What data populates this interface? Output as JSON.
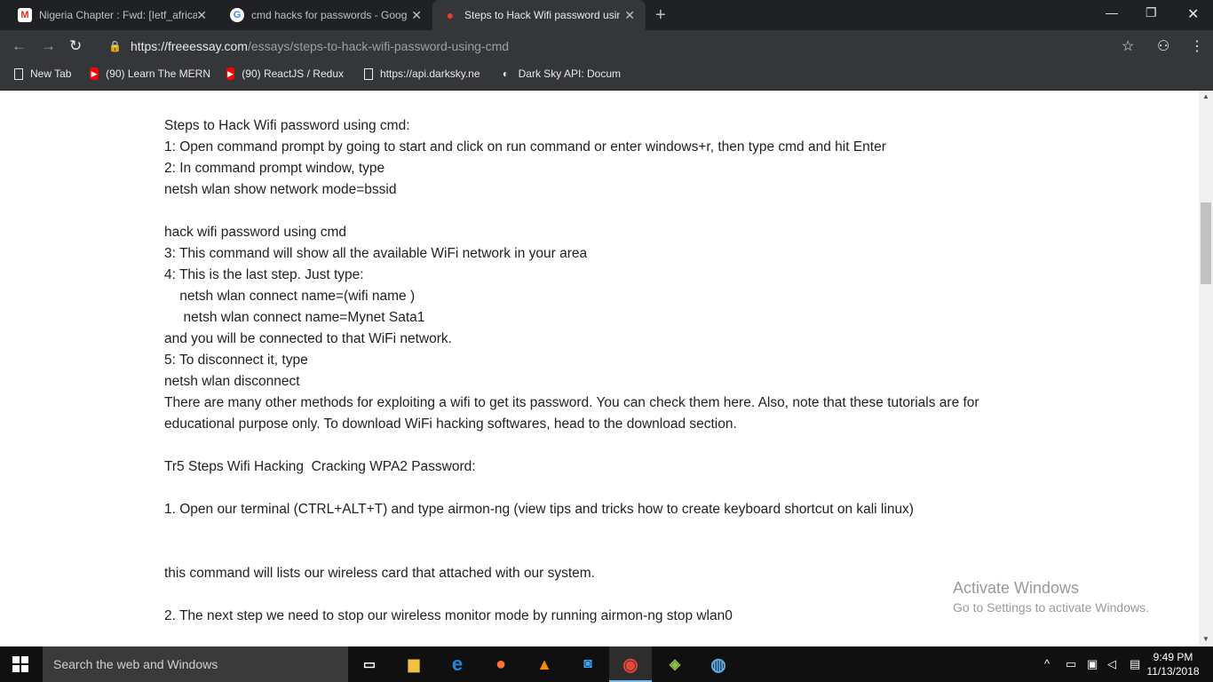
{
  "tabs": [
    {
      "title": "Nigeria Chapter : Fwd: [Ietf_africa",
      "favicon": "gmail-icon",
      "active": false
    },
    {
      "title": "cmd hacks for passwords - Goog",
      "favicon": "google-icon",
      "active": false
    },
    {
      "title": "Steps to Hack Wifi password usin",
      "favicon": "site-apple-icon",
      "active": true
    }
  ],
  "toolbar": {
    "url_host": "https://freeessay.com",
    "url_path": "/essays/steps-to-hack-wifi-password-using-cmd"
  },
  "bookmarks": [
    {
      "label": "New Tab",
      "icon": "page-icon"
    },
    {
      "label": "(90) Learn The MERN",
      "icon": "youtube-icon"
    },
    {
      "label": "(90) ReactJS / Redux",
      "icon": "youtube-icon"
    },
    {
      "label": "https://api.darksky.ne",
      "icon": "page-icon"
    },
    {
      "label": "Dark Sky API: Docum",
      "icon": "darksky-icon"
    }
  ],
  "article": {
    "lines": [
      "Steps to Hack Wifi password using cmd:",
      "1: Open command prompt by going to start and click on run command or enter windows+r, then type cmd and hit Enter",
      "2: In command prompt window, type",
      "netsh wlan show network mode=bssid",
      "",
      "hack wifi password using cmd",
      "3: This command will show all the available WiFi network in your area",
      "4: This is the last step. Just type:",
      "    netsh wlan connect name=(wifi name )",
      "     netsh wlan connect name=Mynet Sata1",
      "and you will be connected to that WiFi network.",
      "5: To disconnect it, type",
      "netsh wlan disconnect",
      "There are many other methods for exploiting a wifi to get its password. You can check them here. Also, note that these tutorials are for",
      "educational purpose only. To download WiFi hacking softwares, head to the download section.",
      "",
      "Tr5 Steps Wifi Hacking  Cracking WPA2 Password:",
      "",
      "1. Open our terminal (CTRL+ALT+T) and type airmon-ng (view tips and tricks how to create keyboard shortcut on kali linux)",
      "",
      "",
      "this command will lists our wireless card that attached with our system.",
      "",
      "2. The next step we need to stop our wireless monitor mode by running airmon-ng stop wlan0"
    ]
  },
  "watermark": {
    "line1": "Activate Windows",
    "line2": "Go to Settings to activate Windows."
  },
  "taskbar": {
    "search_placeholder": "Search the web and Windows",
    "time": "9:49 PM",
    "date": "11/13/2018"
  }
}
